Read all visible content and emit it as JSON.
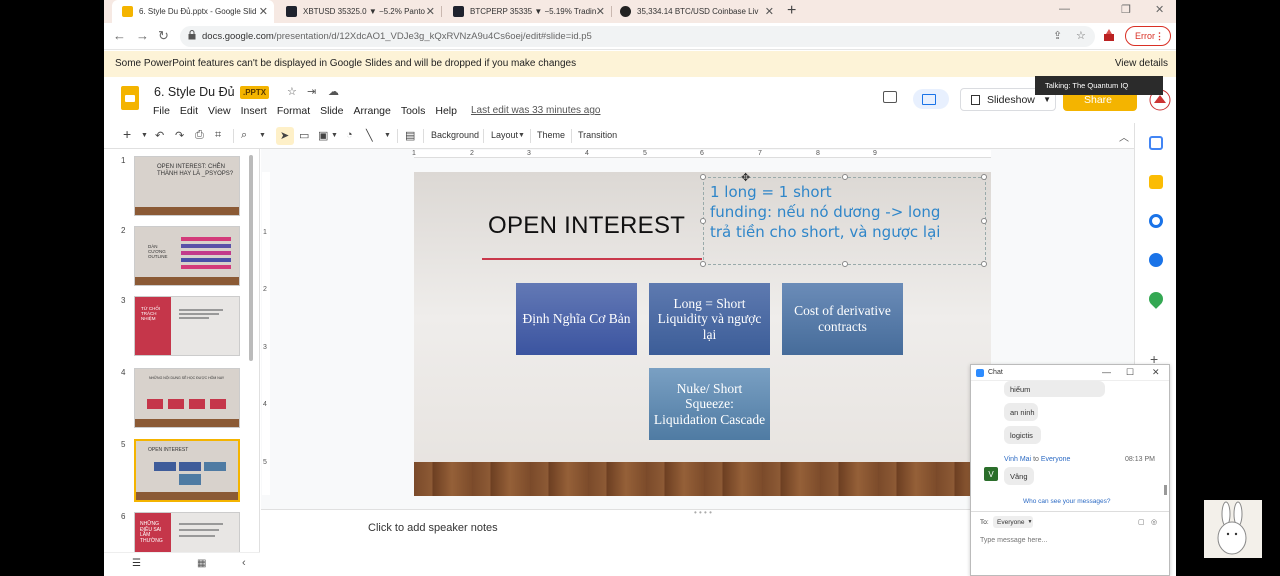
{
  "browser": {
    "tabs": [
      {
        "label": "6. Style Du Đủ.pptx - Google Slid",
        "active": true,
        "color": "#f4b400"
      },
      {
        "label": "XBTUSD 35325.0 ▼ −5.2% Panto",
        "active": false,
        "color": "#1e222d"
      },
      {
        "label": "BTCPERP 35335 ▼ −5.19% Tradin",
        "active": false,
        "color": "#1e222d"
      },
      {
        "label": "35,334.14 BTC/USD Coinbase Liv",
        "active": false,
        "color": "#222222"
      }
    ],
    "new_tab": "+",
    "window_controls": [
      "—",
      "❐",
      "✕"
    ],
    "url_host": "docs.google.com",
    "url_path": "/presentation/d/12XdcAO1_VDJe3g_kQxRVNzA9u4Cs6oej/edit#slide=id.p5",
    "error_label": "Error"
  },
  "banner": {
    "text": "Some PowerPoint features can't be displayed in Google Slides and will be dropped if you make changes",
    "link": "View details"
  },
  "doc": {
    "title": "6. Style Du Đủ",
    "badge": ".PPTX",
    "menu": [
      "File",
      "Edit",
      "View",
      "Insert",
      "Format",
      "Slide",
      "Arrange",
      "Tools",
      "Help"
    ],
    "last_edit": "Last edit was 33 minutes ago",
    "slideshow": "Slideshow",
    "share": "Share",
    "talking": "Talking: The Quantum IQ"
  },
  "toolbar": {
    "background": "Background",
    "layout": "Layout",
    "theme": "Theme",
    "transition": "Transition"
  },
  "ruler": {
    "h": [
      "1",
      "2",
      "3",
      "4",
      "5",
      "6",
      "7",
      "8",
      "9"
    ],
    "v": [
      "1",
      "2",
      "3",
      "4",
      "5"
    ]
  },
  "filmstrip": {
    "slides": [
      {
        "num": "1",
        "text": "OPEN INTEREST: CHÊN THÀNH HAY LÀ _PSYOPS?"
      },
      {
        "num": "2",
        "text": "DÀN CƯƠNG OUTLINE"
      },
      {
        "num": "3",
        "text": "TỪ CHỐI TRÁCH NHIỆM"
      },
      {
        "num": "4",
        "text": "NHỮNG NỘI DUNG SẼ HỌC ĐƯỢC HÔM NAY"
      },
      {
        "num": "5",
        "text": "OPEN INTEREST"
      },
      {
        "num": "6",
        "text": "NHỮNG ĐIỀU SAI LẦM THƯỜNG"
      }
    ]
  },
  "slide": {
    "title": "OPEN INTEREST",
    "textbox_lines": [
      "1 long = 1 short",
      "funding: nếu nó dương -> long",
      "trả tiền cho short, và ngược lại"
    ],
    "boxes": [
      "Định Nghĩa Cơ Bản",
      "Long = Short Liquidity và ngược lại",
      "Cost of derivative contracts",
      "Nuke/ Short Squeeze: Liquidation Cascade"
    ]
  },
  "notes": {
    "placeholder": "Click to add speaker notes"
  },
  "chat": {
    "title": "Chat",
    "messages": [
      "hiểum",
      "an ninh",
      "logictis"
    ],
    "sender_name": "Vinh Mai",
    "sender_to": "to",
    "sender_target": "Everyone",
    "time": "08:13 PM",
    "avatar_letter": "V",
    "last_message": "Vâng",
    "who_can_see": "Who can see your messages?",
    "to_label": "To:",
    "to_value": "Everyone",
    "input_placeholder": "Type message here..."
  }
}
